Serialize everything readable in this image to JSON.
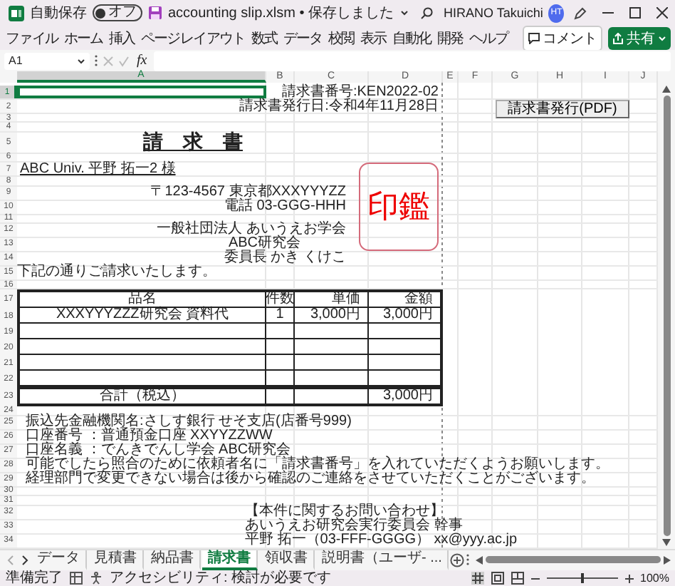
{
  "titlebar": {
    "autosave_label": "自動保存",
    "autosave": {
      "on": false,
      "label": "オフ"
    },
    "filename": "accounting slip.xlsm • 保存しました",
    "user": "HIRANO Takuichi",
    "avatar": "HT"
  },
  "menu": {
    "items": [
      "ファイル",
      "ホーム",
      "挿入",
      "ページレイアウト",
      "数式",
      "データ",
      "校閲",
      "表示",
      "自動化",
      "開発",
      "ヘルプ"
    ],
    "comment_button": "コメント",
    "share_button": "共有"
  },
  "formula_bar": {
    "name_box": "A1",
    "function_label": "fx"
  },
  "sheet": {
    "columns": [
      {
        "label": "A",
        "selected": true
      },
      {
        "label": "B",
        "selected": false
      },
      {
        "label": "C",
        "selected": false
      },
      {
        "label": "D",
        "selected": false
      },
      {
        "label": "E",
        "selected": false
      },
      {
        "label": "F",
        "selected": false
      },
      {
        "label": "G",
        "selected": false
      },
      {
        "label": "H",
        "selected": false
      },
      {
        "label": "I",
        "selected": false
      },
      {
        "label": "J",
        "selected": false
      }
    ],
    "rows": [
      {
        "number": "1",
        "selected": true,
        "kind": "info",
        "cells": [
          {
            "text": "請求書番号:KEN2022-02"
          }
        ]
      },
      {
        "number": "2",
        "selected": false,
        "kind": "info",
        "cells": [
          {
            "text": "請求書発行日:令和4年11月28日"
          }
        ]
      },
      {
        "number": "3",
        "selected": false,
        "kind": "blank"
      },
      {
        "number": "4",
        "selected": false,
        "kind": "blank"
      },
      {
        "number": "5",
        "selected": false,
        "kind": "title",
        "cells": [
          {
            "text": "請　求　書"
          }
        ]
      },
      {
        "number": "6",
        "selected": false,
        "kind": "blank"
      },
      {
        "number": "7",
        "selected": false,
        "kind": "addressee",
        "cells": [
          {
            "text": "ABC Univ. 平野 拓一2 様"
          }
        ]
      },
      {
        "number": "8",
        "selected": false,
        "kind": "blank"
      },
      {
        "number": "9",
        "selected": false,
        "kind": "sender",
        "cells": [
          {
            "text": "〒123-4567 東京都XXXYYYZZ"
          }
        ]
      },
      {
        "number": "10",
        "selected": false,
        "kind": "sender",
        "cells": [
          {
            "text": "電話 03-GGG-HHH"
          }
        ]
      },
      {
        "number": "11",
        "selected": false,
        "kind": "blank"
      },
      {
        "number": "12",
        "selected": false,
        "kind": "sender",
        "cells": [
          {
            "text": "一般社団法人 あいうえお学会"
          }
        ]
      },
      {
        "number": "13",
        "selected": false,
        "kind": "sender-mid",
        "cells": [
          {
            "text": "ABC研究会"
          }
        ]
      },
      {
        "number": "14",
        "selected": false,
        "kind": "sender",
        "cells": [
          {
            "text": "委員長 かき くけこ"
          }
        ]
      },
      {
        "number": "15",
        "selected": false,
        "kind": "lead",
        "cells": [
          {
            "text": "下記の通りご請求いたします。"
          }
        ]
      },
      {
        "number": "16",
        "selected": false,
        "kind": "blank"
      },
      {
        "number": "17",
        "selected": false,
        "kind": "table-head",
        "cells": [
          {
            "text": "品名"
          },
          {
            "text": "件数"
          },
          {
            "text": "単価"
          },
          {
            "text": "金額"
          }
        ]
      },
      {
        "number": "18",
        "selected": false,
        "kind": "table-row",
        "cells": [
          {
            "text": "XXXYYYZZZ研究会 資料代"
          },
          {
            "text": "1"
          },
          {
            "text": "3,000円"
          },
          {
            "text": "3,000円"
          }
        ]
      },
      {
        "number": "19",
        "selected": false,
        "kind": "table-row"
      },
      {
        "number": "20",
        "selected": false,
        "kind": "table-row"
      },
      {
        "number": "21",
        "selected": false,
        "kind": "table-row"
      },
      {
        "number": "22",
        "selected": false,
        "kind": "table-row"
      },
      {
        "number": "23",
        "selected": false,
        "kind": "table-total",
        "cells": [
          {
            "text": "合計（税込）"
          },
          {
            "text": "3,000円"
          }
        ]
      },
      {
        "number": "24",
        "selected": false,
        "kind": "blank"
      },
      {
        "number": "25",
        "selected": false,
        "kind": "note",
        "cells": [
          {
            "text": "振込先金融機関名:さしす銀行 せそ支店(店番号999)"
          }
        ]
      },
      {
        "number": "26",
        "selected": false,
        "kind": "note",
        "cells": [
          {
            "text": "口座番号 ：普通預金口座 XXYYZZWW"
          }
        ]
      },
      {
        "number": "27",
        "selected": false,
        "kind": "note",
        "cells": [
          {
            "text": "口座名義 ：でんきでんし学会 ABC研究会"
          }
        ]
      },
      {
        "number": "28",
        "selected": false,
        "kind": "note",
        "cells": [
          {
            "text": "可能でしたら照合のために依頼者名に「請求書番号」を入れていただくようお願いします。"
          }
        ]
      },
      {
        "number": "29",
        "selected": false,
        "kind": "note",
        "cells": [
          {
            "text": "経理部門で変更できない場合は後から確認のご連絡をさせていただくことがございます。"
          }
        ]
      },
      {
        "number": "30",
        "selected": false,
        "kind": "blank"
      },
      {
        "number": "31",
        "selected": false,
        "kind": "blank"
      },
      {
        "number": "32",
        "selected": false,
        "kind": "contact",
        "cells": [
          {
            "text": "【本件に関するお問い合わせ】"
          }
        ]
      },
      {
        "number": "33",
        "selected": false,
        "kind": "contact",
        "cells": [
          {
            "text": "あいうえお研究会実行委員会 幹事"
          }
        ]
      },
      {
        "number": "34",
        "selected": false,
        "kind": "contact",
        "cells": [
          {
            "text": "平野 拓一（03-FFF-GGGG） xx@yyy.ac.jp"
          }
        ]
      }
    ],
    "button": "請求書発行(PDF)",
    "stamp": "印鑑"
  },
  "sheet_tabs": [
    {
      "label": "データ",
      "selected": false
    },
    {
      "label": "見積書",
      "selected": false
    },
    {
      "label": "納品書",
      "selected": false
    },
    {
      "label": "請求書",
      "selected": true
    },
    {
      "label": "領収書",
      "selected": false
    },
    {
      "label": "説明書（ユーザ‐ ...",
      "selected": false
    }
  ],
  "status_bar": {
    "status": "準備完了",
    "accessibility": "アクセシビリティ: 検討が必要です",
    "zoom": {
      "level": 0.5,
      "label": "100%"
    }
  }
}
